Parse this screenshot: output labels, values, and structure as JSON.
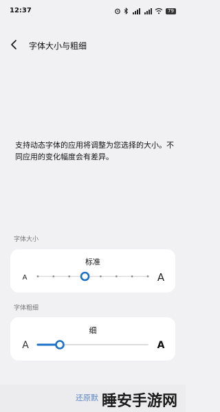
{
  "status_bar": {
    "time": "12:37",
    "battery": "79",
    "icons": [
      "alarm-icon",
      "bluetooth-icon",
      "hd-signal-icon",
      "hd-signal-icon",
      "wifi-icon",
      "battery-icon"
    ]
  },
  "header": {
    "title": "字体大小与粗细"
  },
  "description": "支持动态字体的应用将调整为您选择的大小。不同应用的变化幅度会有差异。",
  "font_size": {
    "section_label": "字体大小",
    "current_label": "标准",
    "small_glyph": "A",
    "large_glyph": "A",
    "steps": 8,
    "selected_step": 3
  },
  "font_weight": {
    "section_label": "字体粗细",
    "current_label": "细",
    "small_glyph": "A",
    "large_glyph": "A",
    "level": 0.2
  },
  "footer": {
    "reset_label": "还原默"
  },
  "watermark": "睡安手游网",
  "colors": {
    "accent": "#1a6fc7",
    "link": "#5a86c6",
    "background": "#f1f1f3"
  }
}
